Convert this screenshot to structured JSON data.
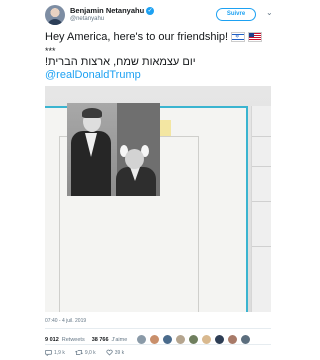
{
  "header": {
    "name": "Benjamin Netanyahu",
    "verified_icon": "verified-check-icon",
    "handle": "@netanyahu",
    "follow_label": "Suivre",
    "menu_icon": "chevron-down-icon"
  },
  "tweet": {
    "line1": "Hey America, here's to our friendship!",
    "flags": [
      "israel-flag-icon",
      "usa-flag-icon"
    ],
    "line2": "***",
    "line3": "יום עצמאות שמח, ארצות הברית!",
    "mention": "@realDonaldTrump"
  },
  "meta": {
    "time": "07:40 - 4 juil. 2019"
  },
  "stats": {
    "retweets_count": "9 012",
    "retweets_label": "Retweets",
    "likes_count": "38 766",
    "likes_label": "J'aime"
  },
  "actions": {
    "reply_count": "1,9 k",
    "retweet_count": "9,0 k",
    "like_count": "39 k"
  },
  "colors": {
    "accent": "#1da1f2",
    "text": "#14171a",
    "secondary": "#657786",
    "photo_frame": "#3ab4d0"
  }
}
